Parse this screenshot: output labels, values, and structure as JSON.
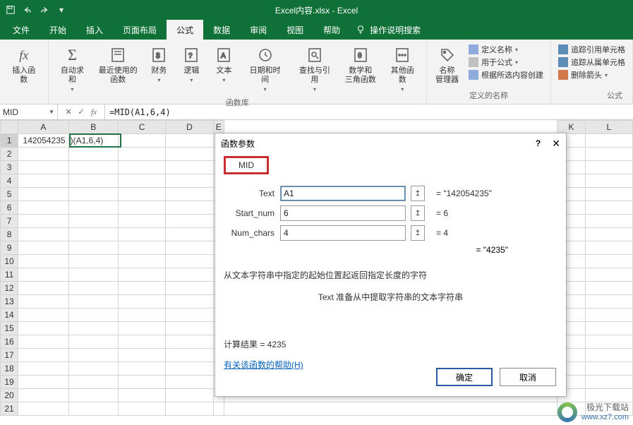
{
  "title": "Excel内容.xlsx - Excel",
  "tabs": {
    "file": "文件",
    "home": "开始",
    "insert": "插入",
    "layout": "页面布局",
    "formula": "公式",
    "data": "数据",
    "review": "审阅",
    "view": "视图",
    "help": "帮助",
    "tellme": "操作说明搜索"
  },
  "ribbon": {
    "insert_fn": "插入函数",
    "autosum": "自动求和",
    "recent": "最近使用的\n函数",
    "financial": "财务",
    "logical": "逻辑",
    "text": "文本",
    "datetime": "日期和时间",
    "lookup": "查找与引用",
    "math": "数学和\n三角函数",
    "more": "其他函数",
    "name_mgr": "名称\n管理器",
    "def_name": "定义名称",
    "use_formula": "用于公式",
    "from_sel": "根据所选内容创建",
    "trace_prec": "追踪引用单元格",
    "trace_dep": "追踪从属单元格",
    "remove_arrows": "删除箭头",
    "group_lib": "函数库",
    "group_names": "定义的名称",
    "group_audit": "公式"
  },
  "namebox": "MID",
  "formula": "=MID(A1,6,4)",
  "cells": {
    "A1": "142054235",
    "B1_display": ")(A1,6,4)"
  },
  "columns": [
    "A",
    "B",
    "C",
    "D",
    "E",
    "K",
    "L"
  ],
  "dialog": {
    "title": "函数参数",
    "fn": "MID",
    "p1label": "Text",
    "p1": "A1",
    "p1eval": "\"142054235\"",
    "p2label": "Start_num",
    "p2": "6",
    "p2eval": "6",
    "p3label": "Num_chars",
    "p3": "4",
    "p3eval": "4",
    "result_eval": "=  \"4235\"",
    "desc": "从文本字符串中指定的起始位置起返回指定长度的字符",
    "hint": "Text  准备从中提取字符串的文本字符串",
    "result": "计算结果 =  4235",
    "help": "有关该函数的帮助(H)",
    "ok": "确定",
    "cancel": "取消"
  },
  "watermark": {
    "brand": "极光下载站",
    "url": "www.xz7.com"
  }
}
